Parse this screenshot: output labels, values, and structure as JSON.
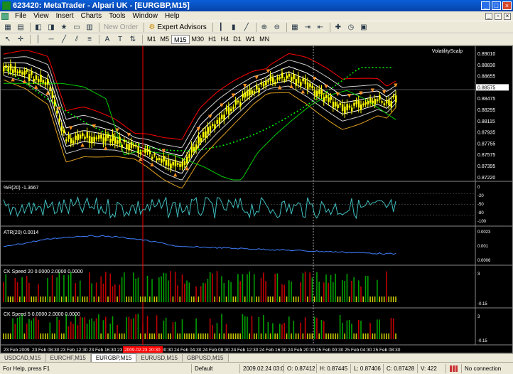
{
  "window": {
    "title": "623420: MetaTrader - Alpari UK - [EURGBP,M15]"
  },
  "menu": [
    "File",
    "View",
    "Insert",
    "Charts",
    "Tools",
    "Window",
    "Help"
  ],
  "toolbar": {
    "new_order": "New Order",
    "expert_advisors": "Expert Advisors",
    "timeframes": [
      "M1",
      "M5",
      "M15",
      "M30",
      "H1",
      "H4",
      "D1",
      "W1",
      "MN"
    ],
    "active_timeframe": "M15"
  },
  "chart": {
    "indicator_label": "VolatilityScalp",
    "price_labels": [
      "0.89010",
      "0.88830",
      "0.88655",
      "0.88575",
      "0.88475",
      "0.88295",
      "0.88115",
      "0.87935",
      "0.87755",
      "0.87575",
      "0.87395",
      "0.87220"
    ],
    "current_price": "0.88575",
    "panels": [
      {
        "label": "%R(20) -1.3667",
        "scale": [
          "0",
          "-20",
          "-50",
          "-80",
          "-100"
        ]
      },
      {
        "label": "ATR(20) 0.0014",
        "scale": [
          "0.0023",
          "0.001",
          "0.0006"
        ]
      },
      {
        "label": "CK Speed 20 0.0000 2.0000 0.0000",
        "scale": [
          "3",
          "-0.15"
        ]
      },
      {
        "label": "CK Speed 5 0.0000 2.0000 0.0000",
        "scale": [
          "3",
          "-0.15"
        ]
      }
    ],
    "time_labels": [
      "23 Feb 2009",
      "23 Feb 08:30",
      "23 Feb 12:30",
      "23 Feb 16:30",
      "23 Feb 20:30",
      "24 Feb 00:30",
      "24 Feb 04:30",
      "24 Feb 08:30",
      "24 Feb 12:30",
      "24 Feb 16:30",
      "24 Feb 20:30",
      "25 Feb 00:30",
      "25 Feb 04:30",
      "25 Feb 08:30"
    ],
    "cursor_time": "2009.02.23 20:30",
    "colors": {
      "background": "#000000",
      "candles": "#ffff00",
      "bands": "#ffffff",
      "upper_band": "#ff0000",
      "ma_fast": "#00cc00",
      "wpr_line": "#40c0c0",
      "atr_line": "#4080ff",
      "hist_green": "#00a000",
      "hist_red": "#c00000",
      "hist_yellow": "#c8c800",
      "cursor_line": "#ff0000"
    }
  },
  "tabs": [
    "USDCAD,M15",
    "EURCHF,M15",
    "EURGBP,M15",
    "EURUSD,M15",
    "GBPUSD,M15"
  ],
  "active_tab": "EURGBP,M15",
  "status": {
    "help": "For Help, press F1",
    "profile": "Default",
    "time": "2009.02.24 03:00",
    "open": "O: 0.87412",
    "high": "H: 0.87445",
    "low": "L: 0.87406",
    "close": "C: 0.87428",
    "volume": "V: 422",
    "connection": "No connection"
  }
}
